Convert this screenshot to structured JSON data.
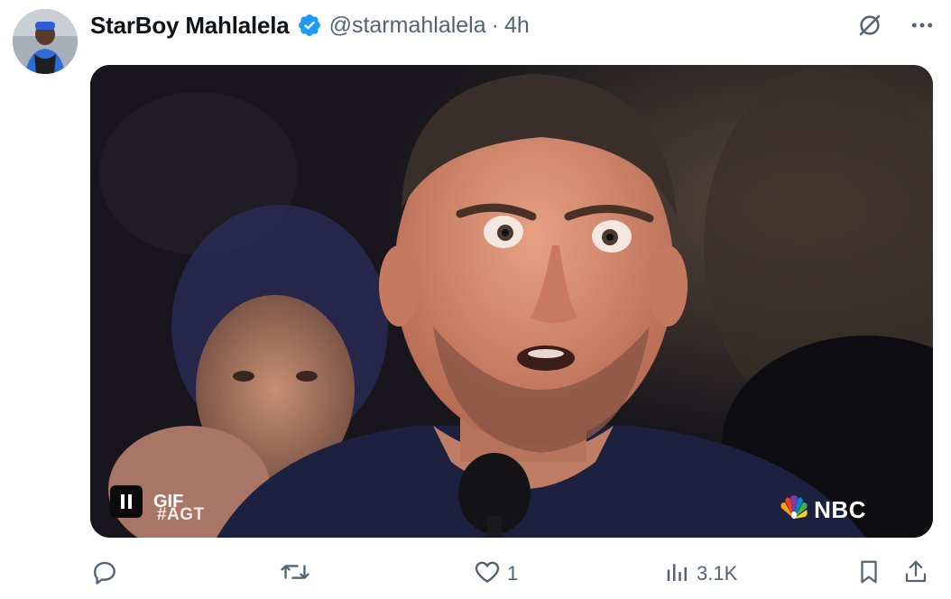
{
  "tweet": {
    "author_name": "StarBoy Mahlalela",
    "handle": "@starmahlalela",
    "separator": "·",
    "time": "4h",
    "verified": true
  },
  "top_actions": {
    "grok_icon": "grok-slash-circle-icon",
    "more_icon": "more-horizontal-icon"
  },
  "media": {
    "type": "gif",
    "gif_label": "GIF",
    "hashtag": "#AGT",
    "network_label": "NBC",
    "pause_icon": "pause-icon",
    "network_logo_icon": "peacock-logo-icon"
  },
  "actions": {
    "reply": {
      "icon": "reply-icon",
      "count": ""
    },
    "retweet": {
      "icon": "retweet-icon",
      "count": ""
    },
    "like": {
      "icon": "heart-icon",
      "count": "1"
    },
    "views": {
      "icon": "views-bar-icon",
      "count": "3.1K"
    },
    "bookmark": {
      "icon": "bookmark-icon"
    },
    "share": {
      "icon": "share-upload-icon"
    }
  },
  "colors": {
    "text_primary": "#0f1419",
    "text_secondary": "#536471",
    "verified_blue": "#1d9bf0"
  }
}
